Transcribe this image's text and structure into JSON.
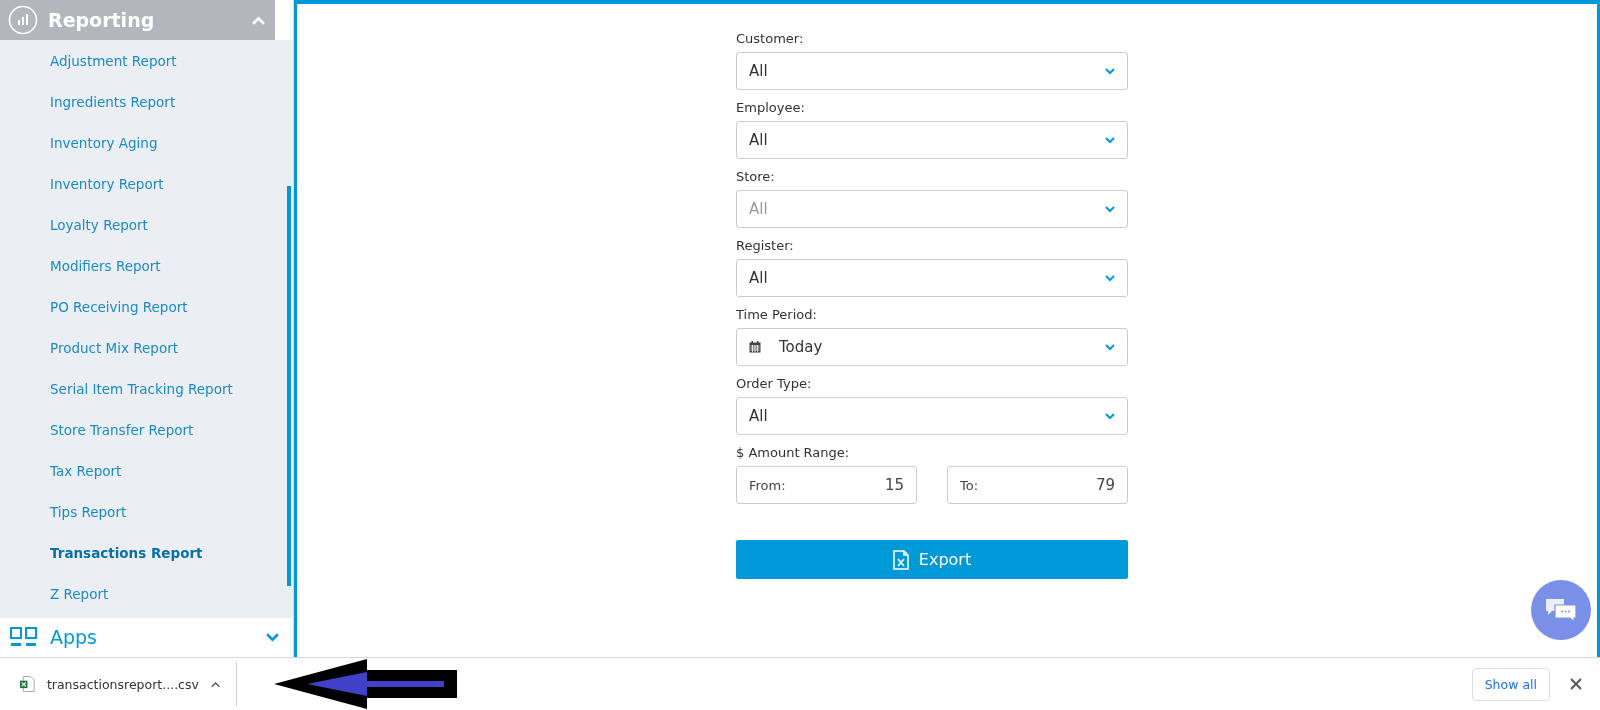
{
  "sidebar": {
    "section": {
      "title": "Reporting",
      "expanded": true
    },
    "items": [
      {
        "label": "Adjustment Report",
        "selected": false
      },
      {
        "label": "Ingredients Report",
        "selected": false
      },
      {
        "label": "Inventory Aging",
        "selected": false
      },
      {
        "label": "Inventory Report",
        "selected": false
      },
      {
        "label": "Loyalty Report",
        "selected": false
      },
      {
        "label": "Modifiers Report",
        "selected": false
      },
      {
        "label": "PO Receiving Report",
        "selected": false
      },
      {
        "label": "Product Mix Report",
        "selected": false
      },
      {
        "label": "Serial Item Tracking Report",
        "selected": false
      },
      {
        "label": "Store Transfer Report",
        "selected": false
      },
      {
        "label": "Tax Report",
        "selected": false
      },
      {
        "label": "Tips Report",
        "selected": false
      },
      {
        "label": "Transactions Report",
        "selected": true
      },
      {
        "label": "Z Report",
        "selected": false
      }
    ],
    "next_section": {
      "title": "Apps",
      "expanded": false
    }
  },
  "form": {
    "fields": [
      {
        "kind": "select",
        "label": "Customer:",
        "value": "All",
        "disabled": false
      },
      {
        "kind": "select",
        "label": "Employee:",
        "value": "All",
        "disabled": false
      },
      {
        "kind": "select",
        "label": "Store:",
        "value": "All",
        "disabled": true
      },
      {
        "kind": "select",
        "label": "Register:",
        "value": "All",
        "disabled": false
      },
      {
        "kind": "date",
        "label": "Time Period:",
        "value": "Today",
        "disabled": false
      },
      {
        "kind": "select",
        "label": "Order Type:",
        "value": "All",
        "disabled": false
      },
      {
        "kind": "range",
        "label": "$ Amount Range:",
        "from_label": "From:",
        "from_value": "15",
        "to_label": "To:",
        "to_value": "79"
      }
    ],
    "export_button": "Export"
  },
  "download_bar": {
    "file_name": "transactionsreport....csv",
    "show_all": "Show all"
  }
}
